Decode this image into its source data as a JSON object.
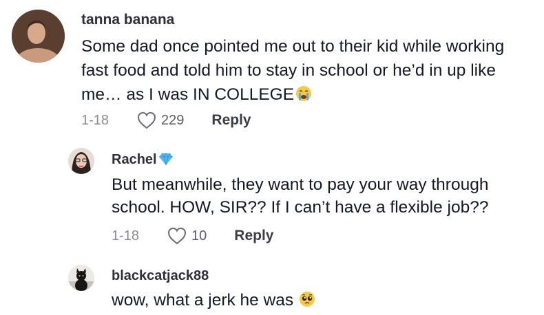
{
  "comments": [
    {
      "username": "tanna banana",
      "text": "Some dad once pointed me out to their kid while working fast food and told him to stay in school or he’d in up like me… as I was IN COLLEGE",
      "emoji": "crying-face-emoji",
      "date": "1-18",
      "likes": "229",
      "reply_label": "Reply"
    },
    {
      "username": "Rachel",
      "badge": "diamond-emoji",
      "text": "But meanwhile, they want to pay your way through school. HOW, SIR?? If I can’t have a flexible job??",
      "date": "1-18",
      "likes": "10",
      "reply_label": "Reply"
    },
    {
      "username": "blackcatjack88",
      "text": "wow, what a jerk he was",
      "emoji": "pleading-face-emoji"
    }
  ]
}
